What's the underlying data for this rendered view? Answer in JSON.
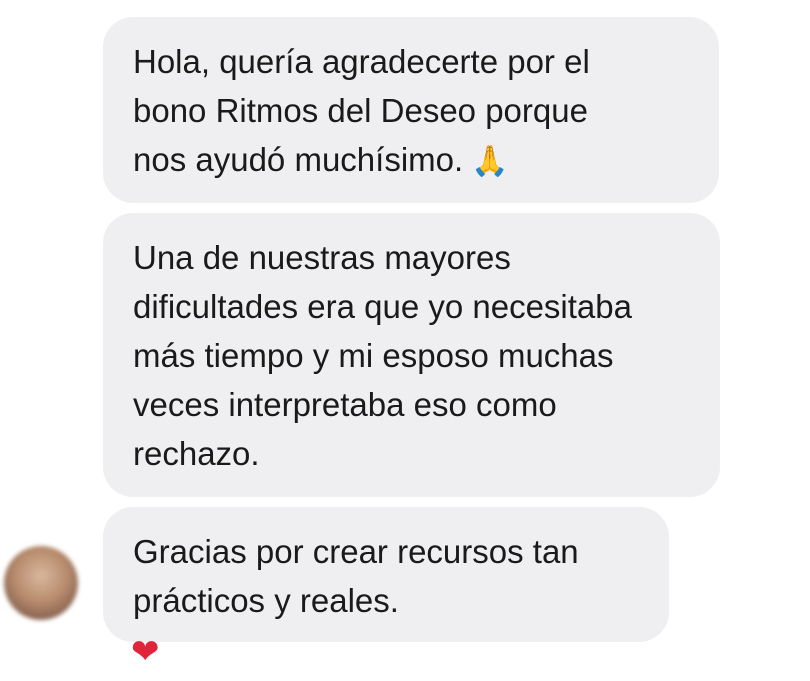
{
  "messages": [
    {
      "lines": [
        "Hola, quería agradecerte por el",
        "bono Ritmos del Deseo porque",
        "nos ayudó muchísimo."
      ],
      "emoji": "🙏"
    },
    {
      "lines": [
        "Una de nuestras mayores",
        "dificultades era que yo necesitaba",
        "más tiempo y mi esposo muchas",
        "veces interpretaba eso como",
        "rechazo."
      ]
    },
    {
      "lines": [
        "Gracias por crear recursos tan",
        "prácticos y reales."
      ]
    }
  ],
  "reaction": "❤",
  "icons": {
    "avatar": "avatar-icon",
    "reaction": "heart-icon",
    "emoji": "folded-hands-icon"
  },
  "colors": {
    "bubble_bg": "#efeff1",
    "text": "#1a1a1a",
    "heart": "#e0253a"
  }
}
